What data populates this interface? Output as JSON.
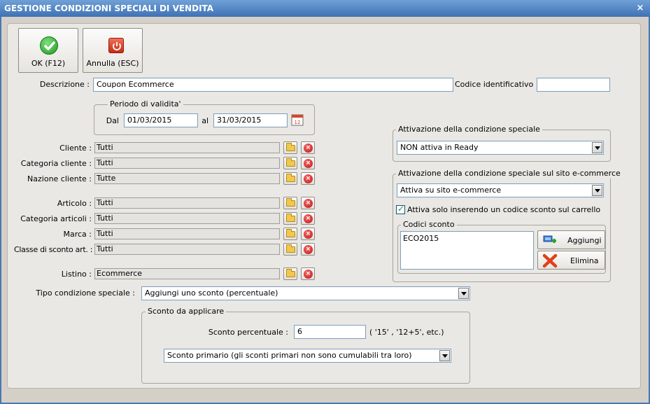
{
  "window": {
    "title": "GESTIONE CONDIZIONI SPECIALI DI VENDITA",
    "close_glyph": "×"
  },
  "toolbar": {
    "ok_label": "OK (F12)",
    "cancel_label": "Annulla (ESC)"
  },
  "descrizione": {
    "label": "Descrizione :",
    "value": "Coupon Ecommerce"
  },
  "codice": {
    "label": "Codice identificativo :",
    "value": ""
  },
  "periodo": {
    "title": "Periodo di validita'",
    "dal_label": "Dal",
    "dal_value": "01/03/2015",
    "al_label": "al",
    "al_value": "31/03/2015"
  },
  "filters": [
    {
      "label": "Cliente :",
      "value": "Tutti"
    },
    {
      "label": "Categoria cliente :",
      "value": "Tutti"
    },
    {
      "label": "Nazione cliente :",
      "value": "Tutte"
    },
    {
      "label": "Articolo :",
      "value": "Tutti"
    },
    {
      "label": "Categoria articoli :",
      "value": "Tutti"
    },
    {
      "label": "Marca :",
      "value": "Tutti"
    },
    {
      "label": "Classe di sconto art. :",
      "value": "Tutti"
    },
    {
      "label": "Listino :",
      "value": "Ecommerce"
    }
  ],
  "del_glyph": "×",
  "attivazione": {
    "title": "Attivazione della condizione speciale",
    "value": "NON attiva in Ready"
  },
  "ecommerce": {
    "title": "Attivazione della condizione speciale sul sito e-commerce",
    "value": "Attiva su sito e-commerce",
    "checkbox_label": "Attiva solo inserendo un codice sconto sul carrello",
    "checkbox_mark": "✓",
    "codici": {
      "title": "Codici sconto",
      "items": [
        "ECO2015"
      ],
      "add_label": "Aggiungi",
      "delete_label": "Elimina"
    }
  },
  "tipo": {
    "label": "Tipo condizione speciale :",
    "value": "Aggiungi uno sconto (percentuale)"
  },
  "sconto": {
    "title": "Sconto da applicare",
    "perc_label": "Sconto percentuale :",
    "perc_value": "6",
    "hint": "( '15' ,  '12+5', etc.)",
    "type_value": "Sconto primario (gli sconti primari non sono cumulabili tra loro)"
  },
  "colors": {
    "title_bar": "#3f72b5",
    "ok_green": "#2eaa2e",
    "cancel_red": "#d63b1f"
  }
}
